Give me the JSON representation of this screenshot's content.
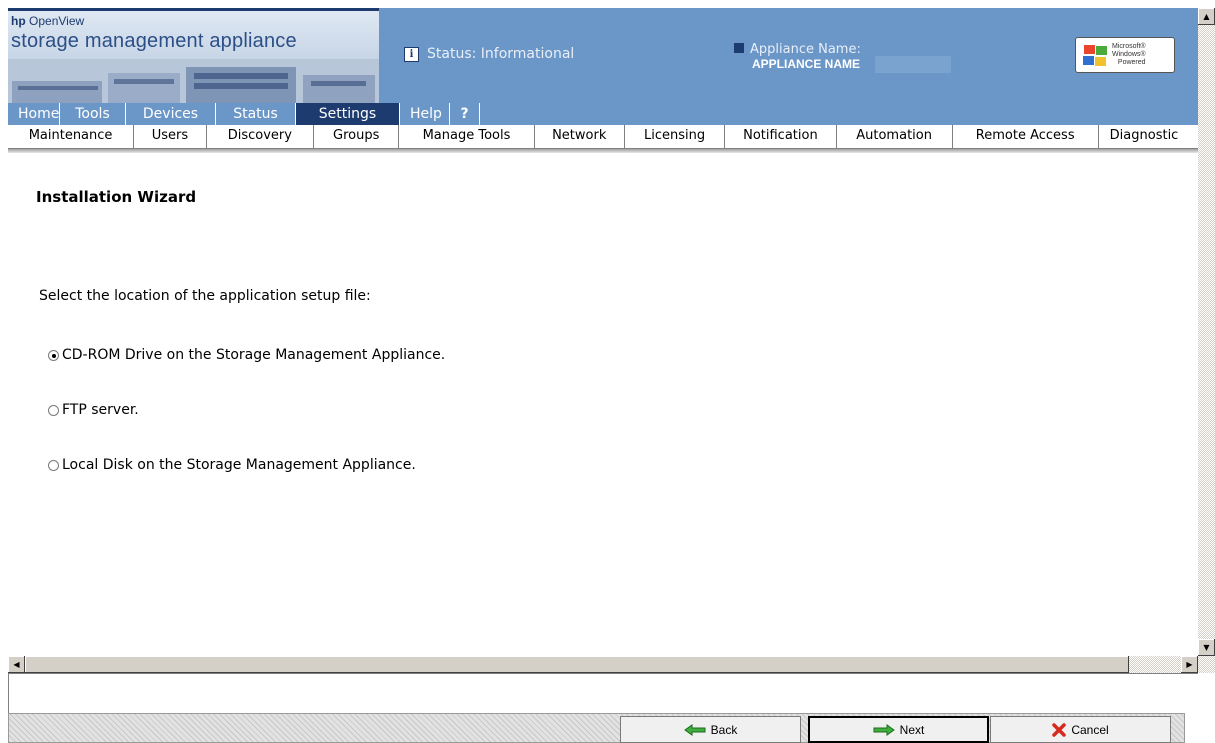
{
  "branding": {
    "company": "hp",
    "product_line": "OpenView",
    "product": "storage management appliance"
  },
  "status": {
    "text": "Status: Informational"
  },
  "appliance": {
    "label": "Appliance Name:",
    "value": "APPLIANCE NAME"
  },
  "windows_badge": {
    "line1": "Microsoft®",
    "line2": "Windows®",
    "line3": "Powered"
  },
  "main_nav": [
    {
      "label": "Home"
    },
    {
      "label": "Tools"
    },
    {
      "label": "Devices"
    },
    {
      "label": "Status"
    },
    {
      "label": "Settings"
    },
    {
      "label": "Help"
    },
    {
      "label": "?"
    }
  ],
  "main_nav_active": "Settings",
  "sub_nav": [
    {
      "label": "Maintenance"
    },
    {
      "label": "Users"
    },
    {
      "label": "Discovery"
    },
    {
      "label": "Groups"
    },
    {
      "label": "Manage Tools"
    },
    {
      "label": "Network"
    },
    {
      "label": "Licensing"
    },
    {
      "label": "Notification"
    },
    {
      "label": "Automation"
    },
    {
      "label": "Remote Access"
    },
    {
      "label": "Diagnostic"
    }
  ],
  "page": {
    "title": "Installation Wizard",
    "prompt": "Select the location of the application setup file:",
    "options": [
      {
        "label": "CD-ROM Drive on the Storage Management Appliance.",
        "checked": true
      },
      {
        "label": "FTP server.",
        "checked": false
      },
      {
        "label": "Local Disk on the Storage Management Appliance.",
        "checked": false
      }
    ]
  },
  "footer": {
    "back_label": "Back",
    "next_label": "Next",
    "cancel_label": "Cancel"
  },
  "colors": {
    "header_blue": "#6b97c8",
    "active_tab": "#1d3b6e"
  }
}
